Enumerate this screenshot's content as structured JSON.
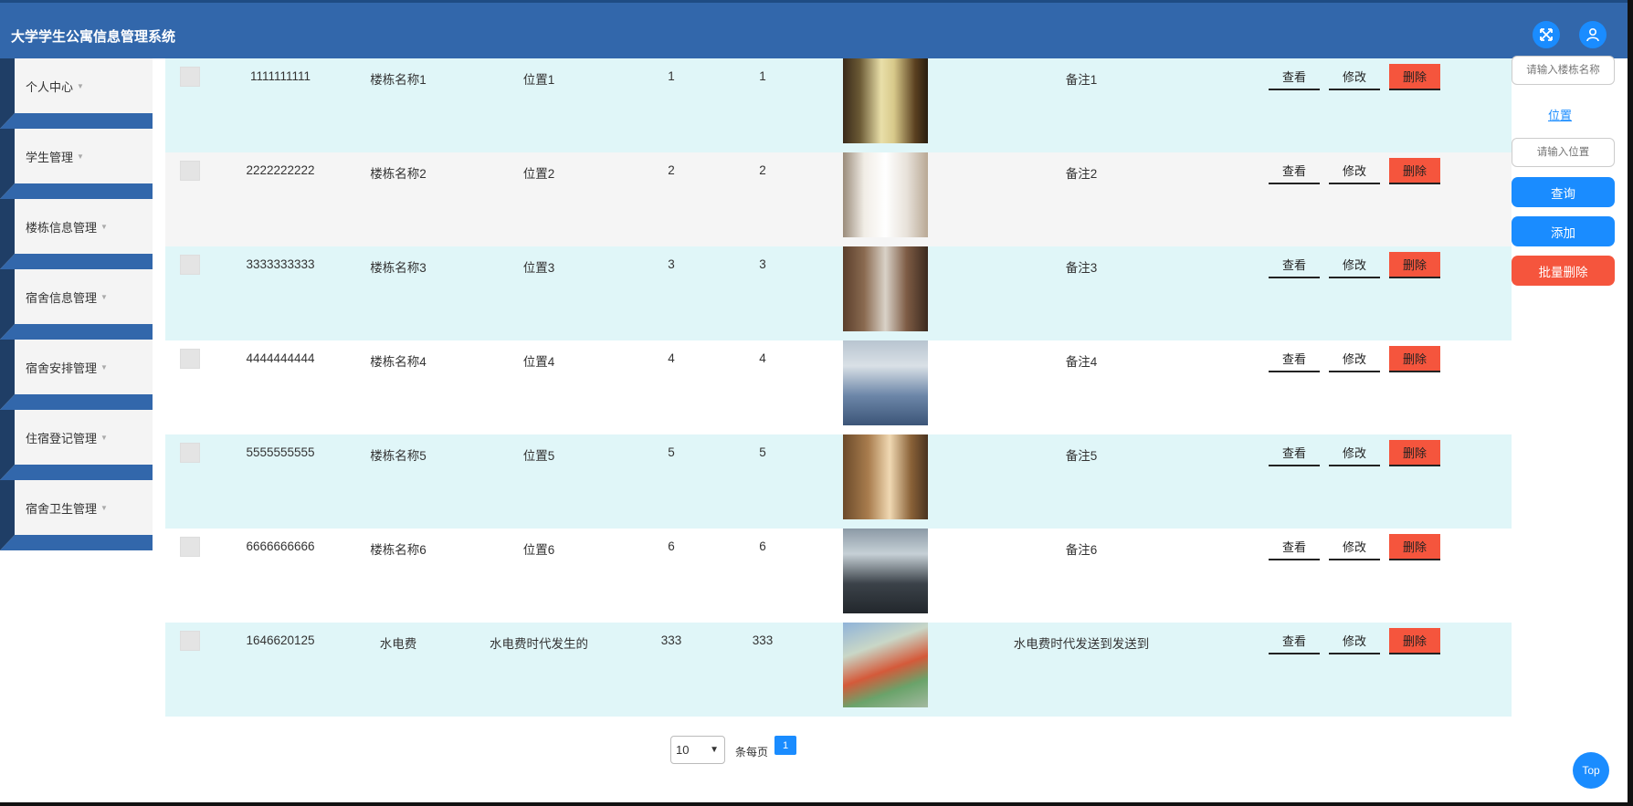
{
  "header": {
    "title": "大学学生公寓信息管理系统",
    "fullscreen_icon": "fullscreen-icon",
    "user_icon": "user-icon",
    "accent": "#3267ab"
  },
  "sidebar": {
    "items": [
      {
        "label": "个人中心"
      },
      {
        "label": "学生管理"
      },
      {
        "label": "楼栋信息管理"
      },
      {
        "label": "宿舍信息管理"
      },
      {
        "label": "宿舍安排管理"
      },
      {
        "label": "住宿登记管理"
      },
      {
        "label": "宿舍卫生管理"
      }
    ]
  },
  "table": {
    "rows": [
      {
        "id": "1111111111",
        "name": "楼栋名称1",
        "location": "位置1",
        "a": "1",
        "b": "1",
        "remark": "备注1"
      },
      {
        "id": "2222222222",
        "name": "楼栋名称2",
        "location": "位置2",
        "a": "2",
        "b": "2",
        "remark": "备注2"
      },
      {
        "id": "3333333333",
        "name": "楼栋名称3",
        "location": "位置3",
        "a": "3",
        "b": "3",
        "remark": "备注3"
      },
      {
        "id": "4444444444",
        "name": "楼栋名称4",
        "location": "位置4",
        "a": "4",
        "b": "4",
        "remark": "备注4"
      },
      {
        "id": "5555555555",
        "name": "楼栋名称5",
        "location": "位置5",
        "a": "5",
        "b": "5",
        "remark": "备注5"
      },
      {
        "id": "6666666666",
        "name": "楼栋名称6",
        "location": "位置6",
        "a": "6",
        "b": "6",
        "remark": "备注6"
      },
      {
        "id": "1646620125",
        "name": "水电费",
        "location": "水电费时代发生的",
        "a": "333",
        "b": "333",
        "remark": "水电费时代发送到发送到"
      }
    ],
    "actions": {
      "view": "查看",
      "edit": "修改",
      "delete": "删除"
    }
  },
  "search": {
    "name_placeholder": "请输入楼栋名称",
    "location_label": "位置",
    "location_placeholder": "请输入位置",
    "query_label": "查询",
    "add_label": "添加",
    "batch_delete_label": "批量删除"
  },
  "pagination": {
    "page_size": "10",
    "per_page_label": "条每页",
    "current_page": "1"
  },
  "top_button": "Top"
}
